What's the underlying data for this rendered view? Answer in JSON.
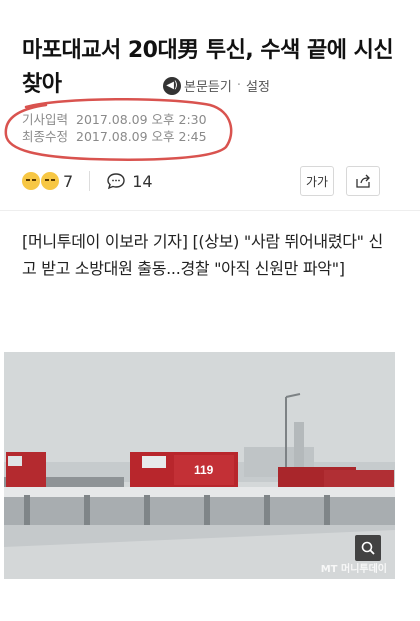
{
  "article": {
    "title": "마포대교서 20대男 투신, 수색 끝에 시신 찾아",
    "tts_label": "본문듣기",
    "settings_label": "설정",
    "separator": "·"
  },
  "meta": {
    "published_label": "기사입력",
    "published_value": "2017.08.09 오후 2:30",
    "modified_label": "최종수정",
    "modified_value": "2017.08.09 오후 2:45"
  },
  "actions": {
    "reaction_count": "7",
    "comment_count": "14",
    "font_size_label": "가가"
  },
  "body": {
    "text": "[머니투데이 이보라 기자] [(상보) \"사람 뛰어내렸다\" 신고 받고 소방대원 출동...경찰 \"아직 신원만 파악\"]"
  },
  "photo": {
    "truck_label": "119",
    "watermark": "MT 머니투데이"
  },
  "colors": {
    "annotation_red": "#d9534f",
    "truck_red": "#c0282d"
  },
  "icons": [
    "speaker-icon",
    "emoji-sad-icon",
    "comment-icon",
    "share-icon",
    "zoom-icon"
  ]
}
